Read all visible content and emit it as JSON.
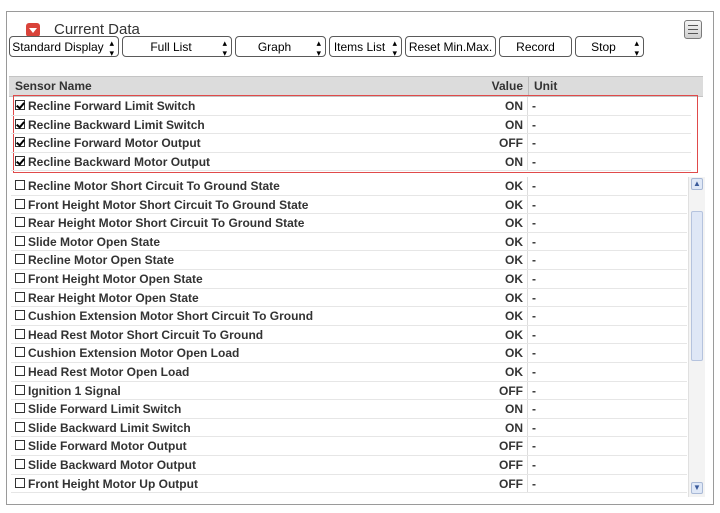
{
  "panel": {
    "title": "Current Data"
  },
  "toolbar": {
    "standard_display": "Standard Display",
    "full_list": "Full List",
    "graph": "Graph",
    "items_list": "Items List",
    "reset_min_max": "Reset Min.Max.",
    "record": "Record",
    "stop": "Stop",
    "dropdown_arrows": "▲▼"
  },
  "table": {
    "columns": {
      "name": "Sensor Name",
      "value": "Value",
      "unit": "Unit"
    },
    "selected_rows": [
      {
        "name": "Recline Forward Limit Switch",
        "value": "ON",
        "unit": "-",
        "checked": true
      },
      {
        "name": "Recline Backward Limit Switch",
        "value": "ON",
        "unit": "-",
        "checked": true
      },
      {
        "name": "Recline Forward Motor Output",
        "value": "OFF",
        "unit": "-",
        "checked": true
      },
      {
        "name": "Recline Backward Motor Output",
        "value": "ON",
        "unit": "-",
        "checked": true
      }
    ],
    "rows": [
      {
        "name": "Recline Motor Short Circuit To Ground State",
        "value": "OK",
        "unit": "-",
        "checked": false
      },
      {
        "name": "Front Height Motor Short Circuit To Ground State",
        "value": "OK",
        "unit": "-",
        "checked": false
      },
      {
        "name": "Rear Height Motor Short Circuit To Ground State",
        "value": "OK",
        "unit": "-",
        "checked": false
      },
      {
        "name": "Slide Motor Open State",
        "value": "OK",
        "unit": "-",
        "checked": false
      },
      {
        "name": "Recline Motor Open State",
        "value": "OK",
        "unit": "-",
        "checked": false
      },
      {
        "name": "Front Height Motor Open State",
        "value": "OK",
        "unit": "-",
        "checked": false
      },
      {
        "name": "Rear Height Motor Open State",
        "value": "OK",
        "unit": "-",
        "checked": false
      },
      {
        "name": "Cushion Extension Motor Short Circuit To Ground",
        "value": "OK",
        "unit": "-",
        "checked": false
      },
      {
        "name": "Head Rest Motor Short Circuit To Ground",
        "value": "OK",
        "unit": "-",
        "checked": false
      },
      {
        "name": "Cushion Extension Motor Open Load",
        "value": "OK",
        "unit": "-",
        "checked": false
      },
      {
        "name": "Head Rest Motor Open Load",
        "value": "OK",
        "unit": "-",
        "checked": false
      },
      {
        "name": "Ignition 1 Signal",
        "value": "OFF",
        "unit": "-",
        "checked": false
      },
      {
        "name": "Slide Forward Limit Switch",
        "value": "ON",
        "unit": "-",
        "checked": false
      },
      {
        "name": "Slide Backward Limit Switch",
        "value": "ON",
        "unit": "-",
        "checked": false
      },
      {
        "name": "Slide Forward Motor Output",
        "value": "OFF",
        "unit": "-",
        "checked": false
      },
      {
        "name": "Slide Backward Motor Output",
        "value": "OFF",
        "unit": "-",
        "checked": false
      },
      {
        "name": "Front Height Motor Up Output",
        "value": "OFF",
        "unit": "-",
        "checked": false
      }
    ]
  },
  "icons": {
    "collapse": "collapse-icon",
    "menu": "menu-icon",
    "scroll_up": "scroll-up-icon",
    "scroll_down": "scroll-down-icon"
  },
  "colors": {
    "highlight_border": "#e04a4a",
    "collapse_icon": "#d9433a",
    "header_background": "#dcdcdc"
  }
}
